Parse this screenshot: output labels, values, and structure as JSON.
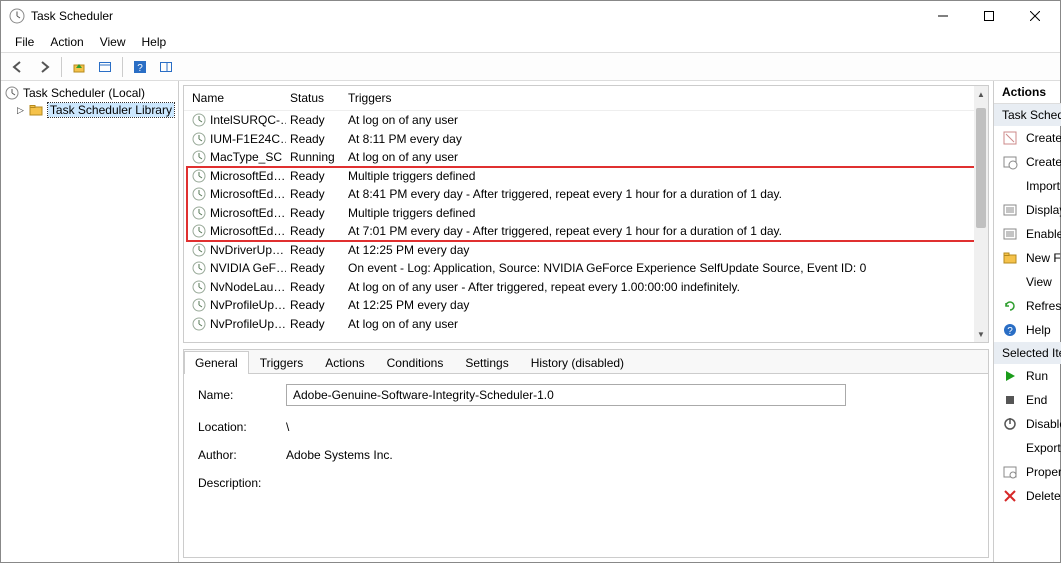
{
  "window": {
    "title": "Task Scheduler"
  },
  "menu": {
    "file": "File",
    "action": "Action",
    "view": "View",
    "help": "Help"
  },
  "tree": {
    "root": "Task Scheduler (Local)",
    "library": "Task Scheduler Library"
  },
  "columns": {
    "name": "Name",
    "status": "Status",
    "triggers": "Triggers"
  },
  "tasks": [
    {
      "name": "IntelSURQC-…",
      "status": "Ready",
      "triggers": "At log on of any user"
    },
    {
      "name": "IUM-F1E24C…",
      "status": "Ready",
      "triggers": "At 8:11 PM every day"
    },
    {
      "name": "MacType_SC",
      "status": "Running",
      "triggers": "At log on of any user"
    },
    {
      "name": "MicrosoftEd…",
      "status": "Ready",
      "triggers": "Multiple triggers defined"
    },
    {
      "name": "MicrosoftEd…",
      "status": "Ready",
      "triggers": "At 8:41 PM every day - After triggered, repeat every 1 hour for a duration of 1 day."
    },
    {
      "name": "MicrosoftEd…",
      "status": "Ready",
      "triggers": "Multiple triggers defined"
    },
    {
      "name": "MicrosoftEd…",
      "status": "Ready",
      "triggers": "At 7:01 PM every day - After triggered, repeat every 1 hour for a duration of 1 day."
    },
    {
      "name": "NvDriverUp…",
      "status": "Ready",
      "triggers": "At 12:25 PM every day"
    },
    {
      "name": "NVIDIA GeF…",
      "status": "Ready",
      "triggers": "On event - Log: Application, Source: NVIDIA GeForce Experience SelfUpdate Source, Event ID: 0"
    },
    {
      "name": "NvNodeLau…",
      "status": "Ready",
      "triggers": "At log on of any user - After triggered, repeat every 1.00:00:00 indefinitely."
    },
    {
      "name": "NvProfileUp…",
      "status": "Ready",
      "triggers": "At 12:25 PM every day"
    },
    {
      "name": "NvProfileUp…",
      "status": "Ready",
      "triggers": "At log on of any user"
    }
  ],
  "highlight": {
    "start": 3,
    "end": 6
  },
  "detail_tabs": {
    "general": "General",
    "triggers": "Triggers",
    "actions": "Actions",
    "conditions": "Conditions",
    "settings": "Settings",
    "history": "History (disabled)"
  },
  "detail_labels": {
    "name": "Name:",
    "location": "Location:",
    "author": "Author:",
    "description": "Description:"
  },
  "detail": {
    "name": "Adobe-Genuine-Software-Integrity-Scheduler-1.0",
    "location": "\\",
    "author": "Adobe Systems Inc.",
    "description": ""
  },
  "actions": {
    "header": "Actions",
    "section1": "Task Scheduler Library",
    "section2": "Selected Item",
    "items1": [
      {
        "key": "create_basic",
        "label": "Create Basic Task…",
        "icon": "wizard"
      },
      {
        "key": "create_task",
        "label": "Create Task…",
        "icon": "task"
      },
      {
        "key": "import_task",
        "label": "Import Task…",
        "icon": "blank"
      },
      {
        "key": "display_running",
        "label": "Display All Runni…",
        "icon": "list"
      },
      {
        "key": "enable_history",
        "label": "Enable All Tasks H…",
        "icon": "list"
      },
      {
        "key": "new_folder",
        "label": "New Folder…",
        "icon": "folder"
      },
      {
        "key": "view",
        "label": "View",
        "icon": "blank",
        "sub": true
      },
      {
        "key": "refresh",
        "label": "Refresh",
        "icon": "refresh"
      },
      {
        "key": "help",
        "label": "Help",
        "icon": "help"
      }
    ],
    "items2": [
      {
        "key": "run",
        "label": "Run",
        "icon": "run"
      },
      {
        "key": "end",
        "label": "End",
        "icon": "end"
      },
      {
        "key": "disable",
        "label": "Disable",
        "icon": "disable"
      },
      {
        "key": "export",
        "label": "Export…",
        "icon": "blank"
      },
      {
        "key": "properties",
        "label": "Properties",
        "icon": "props"
      },
      {
        "key": "delete",
        "label": "Delete",
        "icon": "delete"
      }
    ]
  }
}
